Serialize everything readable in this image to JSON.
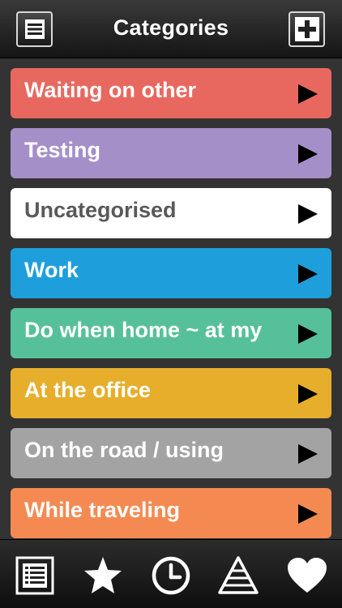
{
  "header": {
    "title": "Categories",
    "menu_icon": "list-menu-icon",
    "add_icon": "plus-icon"
  },
  "categories": [
    {
      "label": "Waiting on other",
      "color": "#E8685F"
    },
    {
      "label": "Testing",
      "color": "#A58FC9"
    },
    {
      "label": "Uncategorised",
      "color": "#FFFFFF"
    },
    {
      "label": "Work",
      "color": "#1E9FDC"
    },
    {
      "label": "Do when home ~ at my",
      "color": "#56C09A"
    },
    {
      "label": "At the office",
      "color": "#E6AE2B"
    },
    {
      "label": "On the road / using",
      "color": "#A3A3A3"
    },
    {
      "label": "While traveling",
      "color": "#F48A52"
    }
  ],
  "footer": {
    "tabs": [
      {
        "icon": "list-icon"
      },
      {
        "icon": "star-icon"
      },
      {
        "icon": "clock-icon"
      },
      {
        "icon": "pyramid-icon"
      },
      {
        "icon": "heart-icon"
      }
    ]
  }
}
